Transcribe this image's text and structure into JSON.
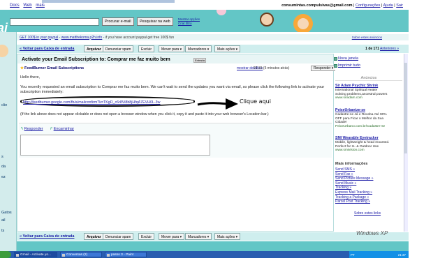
{
  "gbar": {
    "links": [
      "Docs",
      "Web",
      "mais"
    ],
    "email": "consumintas.compulsivas@gmail.com",
    "config": "Configurações",
    "help": "Ajuda",
    "logout": "Sair",
    "separator": "|"
  },
  "header": {
    "search_mail": "Procurar e-mail",
    "search_web": "Pesquisar na web",
    "show_options": "Mostrar opções",
    "create_filter": "Criar filtro"
  },
  "sidebar": {
    "items": [
      "clie",
      "s",
      "da",
      "ez",
      "Gatos",
      "ail",
      "ts"
    ]
  },
  "adbar": {
    "domain": "GET 100$ in your paypal",
    "sep": " - ",
    "domain2": "www.matthekoma.p2h.info",
    "text": " - if you have account paypal get free 100$ fun",
    "more": "Sobre estes anúncios"
  },
  "toolbar": {
    "back": "« Voltar para Caixa de entrada",
    "archive": "Arquivar",
    "spam": "Denunciar spam",
    "delete": "Excluir",
    "move": "Mover para ▾",
    "labels": "Marcadores ▾",
    "more": "Mais ações ▾",
    "count_prefix": "1 de 171",
    "previous": "Anteriores »"
  },
  "message": {
    "subject": "Activate your Email Subscription to: Comprar me faz muito bem",
    "label": "Entrada",
    "sender": "FeedBurner Email Subscriptions",
    "details": "mostrar detalhes",
    "date": "21:31 (5 minutos atrás)",
    "reply_menu": "Responder",
    "greeting": "Hello there,",
    "body": "You recently requested an email subscription to Comprar me faz muito bem. We can't wait to send the updates you want via email, so please click the following link to activate your subscription immediately:",
    "link": "http://feedburner.google.com/fb/a/mailconfirm?k=TKgD_c6r8Vi8b8jHfqA7EVH0L-3w",
    "annotation": "Clique aqui",
    "note": "(If the link above does not appear clickable or does not open a browser window when you click it, copy it and paste it into your web browser's Location bar.)",
    "reply": "Responder",
    "forward": "Encaminhar"
  },
  "rightcol": {
    "new_window": "Nova janela",
    "print_all": "Imprimir tudo",
    "ads_heading": "Anúncios",
    "ads": [
      {
        "title": "Sir Adam Psychic Shrink",
        "lines": [
          "International Spiritual Healer",
          "Solving problems,ancestral powers"
        ],
        "url": "www.siradam.com"
      },
      {
        "title": "PeixeUrbanize-se",
        "lines": [
          "Cadastre-se Já e Receba Até 90%",
          "OFF para Ficar o Melhor da Sua",
          "Cidade!"
        ],
        "url": "PeixeUrbano.com.br/Cadastre-se"
      },
      {
        "title": "SMI Wearable Eyetracker",
        "lines": [
          "Mobile, lightweight & head mounted.",
          "Perfect for In- & Outdoor Use"
        ],
        "url": "www.smivision.com"
      }
    ],
    "more_info_heading": "Mais informações",
    "more_info": [
      "Send SMS »",
      "Send Fax »",
      "Send Picture Message »",
      "Send Music »",
      "Tracking »",
      "Express Mail Tracking »",
      "Tracking a Package »",
      "Parcel Post Tracking »"
    ],
    "about_ads": "Sobre estes links"
  },
  "taskbar": {
    "tasks": [
      "Gmail - Activate yo...",
      "Conversas (2)",
      "passo 3 - Paint"
    ],
    "lang": "PT",
    "clock": "21:37"
  },
  "branding": {
    "windows": "Windows XP"
  },
  "colors": {
    "teal": "#63c6c6",
    "link": "#1a1aa6",
    "taskbar": "#2a5db0"
  }
}
